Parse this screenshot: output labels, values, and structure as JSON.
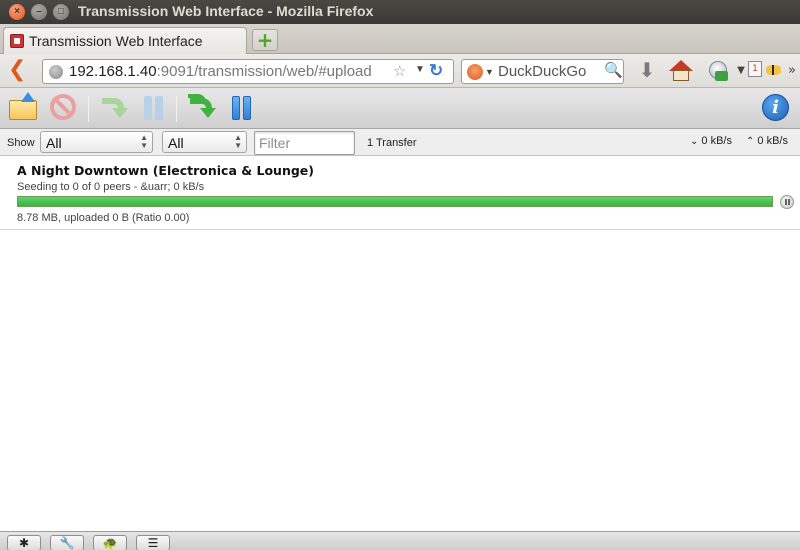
{
  "window": {
    "title": "Transmission Web Interface - Mozilla Firefox"
  },
  "browser": {
    "tab_label": "Transmission Web Interface",
    "new_tab_symbol": "+",
    "url_host": "192.168.1.40",
    "url_rest": ":9091/transmission/web/#upload",
    "search_placeholder": "DuckDuckGo",
    "extension_badge": "1"
  },
  "filter_bar": {
    "show_label": "Show",
    "status_filter": "All",
    "tracker_filter": "All",
    "filter_placeholder": "Filter",
    "transfer_count": "1 Transfer",
    "download_rate": "0 kB/s",
    "upload_rate": "0 kB/s"
  },
  "torrents": [
    {
      "name": "A Night Downtown (Electronica & Lounge)",
      "peers": "Seeding to 0 of 0 peers - &uarr; 0 kB/s",
      "progress_percent": 100,
      "progress_color": "#36b446",
      "details": "8.78 MB, uploaded 0 B (Ratio 0.00)"
    }
  ],
  "icons": {
    "toolbar": [
      "open-torrent-icon",
      "remove-torrent-icon",
      "resume-selected-icon",
      "pause-selected-icon",
      "resume-all-icon",
      "pause-all-icon",
      "info-icon"
    ],
    "bottom": [
      "settings-icon",
      "preferences-icon",
      "turtle-icon",
      "sort-icon"
    ]
  },
  "colors": {
    "accent_blue": "#2f7fd6",
    "progress_green": "#36b446",
    "firefox_back_orange": "#e05a1f"
  }
}
